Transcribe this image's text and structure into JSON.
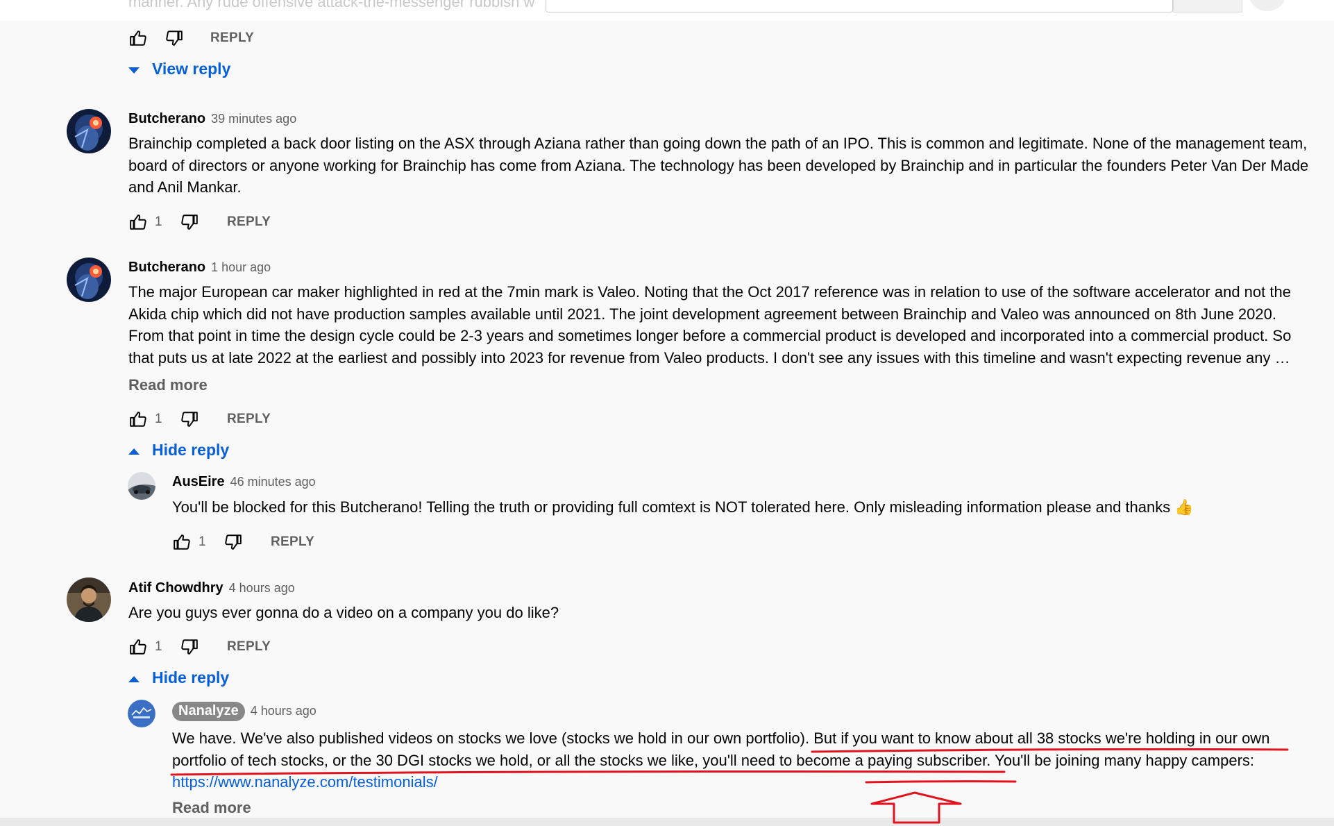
{
  "top": {
    "faded_text": "manner. Any rude offensive attack-the-messenger rubbish w",
    "view_reply_label": "View reply",
    "reply_label": "REPLY"
  },
  "comments": [
    {
      "author": "Butcherano",
      "time": "39 minutes ago",
      "lines": [
        "Brainchip completed a back door listing on the ASX through Aziana rather than going down the path of an IPO.  This is common and legitimate.  None of the management team,",
        "board of directors or anyone working for Brainchip has come from Aziana.  The technology has been developed by Brainchip and in particular the founders Peter Van Der Made",
        "and Anil Mankar."
      ],
      "likes": "1",
      "reply_label": "REPLY"
    },
    {
      "author": "Butcherano",
      "time": "1 hour ago",
      "lines": [
        "The major European car maker highlighted in red at the 7min mark is Valeo.  Noting that the Oct 2017 reference was in relation to use of the software accelerator and not the",
        "Akida chip which did not have production samples available until 2021.  The joint development agreement between Brainchip and Valeo was announced on 8th June 2020.",
        "From that point in time the design cycle could be 2-3 years and sometimes longer before a commercial product is developed and incorporated into a commercial product.  So",
        "that puts us at late 2022 at the earliest and possibly into 2023 for revenue from Valeo products.  I don't see any issues with this timeline and wasn't expecting revenue any …"
      ],
      "read_more": "Read more",
      "likes": "1",
      "reply_label": "REPLY",
      "toggle_label": "Hide reply",
      "reply": {
        "author": "AusEire",
        "time": "46 minutes ago",
        "text": "You'll be blocked for this Butcherano! Telling the truth or providing full comtext is NOT tolerated here. Only misleading information please and thanks 👍",
        "likes": "1",
        "reply_label": "REPLY"
      }
    },
    {
      "author": "Atif Chowdhry",
      "time": "4 hours ago",
      "text": "Are you guys ever gonna do a video on a company you do like?",
      "likes": "1",
      "reply_label": "REPLY",
      "toggle_label": "Hide reply",
      "reply": {
        "author": "Nanalyze",
        "time": "4 hours ago",
        "line1_a": "We have. We've also published videos on stocks we love (stocks we hold in our own portfolio). ",
        "line1_b": "But if you want to know about all 38 stocks we're holding in our own",
        "line2_a": "portfolio of tech stocks, or the 30 DGI stocks we hold, or all the stocks we like, you'll need to become a paying subscriber.",
        "line2_b": " You'll be joining many happy campers:",
        "link": "https://www.nanalyze.com/testimonials/",
        "read_more": "Read more"
      }
    }
  ],
  "colors": {
    "link_blue": "#065fd4",
    "annotation_red": "#e0141e",
    "badge_gray": "#888888"
  },
  "icons": [
    "thumbs-up-icon",
    "thumbs-down-icon",
    "caret-down-icon",
    "caret-up-icon",
    "arrow-up-outline-icon"
  ]
}
